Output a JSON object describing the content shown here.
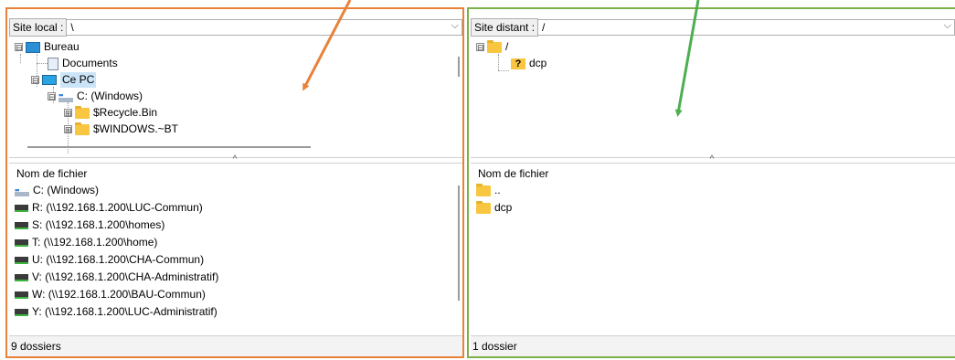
{
  "local": {
    "site_label": "Site local :",
    "path": "\\",
    "tree": [
      {
        "label": "Bureau",
        "icon": "desktop-icon",
        "expander": "⊟"
      },
      {
        "label": "Documents",
        "icon": "document-icon",
        "expander": ""
      },
      {
        "label": "Ce PC",
        "icon": "computer-icon",
        "expander": "⊟"
      },
      {
        "label": "C: (Windows)",
        "icon": "drive-icon",
        "expander": "⊟"
      },
      {
        "label": "$Recycle.Bin",
        "icon": "folder-icon",
        "expander": "⊞"
      },
      {
        "label": "$WINDOWS.~BT",
        "icon": "folder-icon",
        "expander": "⊞"
      }
    ],
    "column_header": "Nom de fichier",
    "files": [
      {
        "label": "C: (Windows)",
        "icon": "drive-icon"
      },
      {
        "label": "R: (\\\\192.168.1.200\\LUC-Commun)",
        "icon": "network-drive-icon"
      },
      {
        "label": "S: (\\\\192.168.1.200\\homes)",
        "icon": "network-drive-icon"
      },
      {
        "label": "T: (\\\\192.168.1.200\\home)",
        "icon": "network-drive-icon"
      },
      {
        "label": "U: (\\\\192.168.1.200\\CHA-Commun)",
        "icon": "network-drive-icon"
      },
      {
        "label": "V: (\\\\192.168.1.200\\CHA-Administratif)",
        "icon": "network-drive-icon"
      },
      {
        "label": "W: (\\\\192.168.1.200\\BAU-Commun)",
        "icon": "network-drive-icon"
      },
      {
        "label": "Y: (\\\\192.168.1.200\\LUC-Administratif)",
        "icon": "network-drive-icon"
      }
    ],
    "status": "9 dossiers",
    "border_color": "#e8823a"
  },
  "remote": {
    "site_label": "Site distant :",
    "path": "/",
    "tree": [
      {
        "label": "/",
        "icon": "folder-icon",
        "expander": "⊟"
      },
      {
        "label": "dcp",
        "icon": "unknown-folder-icon",
        "expander": ""
      }
    ],
    "column_header": "Nom de fichier",
    "files": [
      {
        "label": "..",
        "icon": "folder-icon"
      },
      {
        "label": "dcp",
        "icon": "folder-icon"
      }
    ],
    "status": "1 dossier",
    "border_color": "#7cb04a"
  },
  "annotations": {
    "arrow_local_color": "#e8823a",
    "arrow_remote_color": "#4caf50"
  }
}
